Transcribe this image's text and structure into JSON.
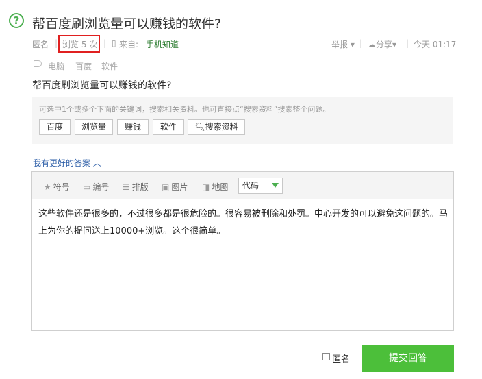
{
  "question": {
    "icon": "question-circle-icon",
    "title": "帮百度刷浏览量可以赚钱的软件?",
    "body": "帮百度刷浏览量可以赚钱的软件?"
  },
  "meta": {
    "author": "匿名",
    "views": "浏览 5 次",
    "source_prefix": "来自:",
    "source": "手机知道",
    "report": "举报",
    "share": "分享",
    "time": "今天 01:17",
    "highlight_color": "#e02020"
  },
  "tags": [
    "电脑",
    "百度",
    "软件"
  ],
  "keywords": {
    "hint": "可选中1个或多个下面的关键词，搜索相关资料。也可直接点“搜索资料”搜索整个问题。",
    "buttons": [
      "百度",
      "浏览量",
      "赚钱",
      "软件"
    ],
    "search_button": "搜索资料"
  },
  "better_answer": "我有更好的答案",
  "editor": {
    "toolbar": [
      "符号",
      "编号",
      "排版",
      "图片",
      "地图"
    ],
    "code_select": "代码",
    "content": "这些软件还是很多的，不过很多都是很危险的。很容易被删除和处罚。中心开发的可以避免这问题的。马上为你的提问送上10000+浏览。这个很简单。"
  },
  "footer": {
    "anonymous_label": "匿名",
    "submit_label": "提交回答",
    "submit_color": "#4cbf3a"
  }
}
